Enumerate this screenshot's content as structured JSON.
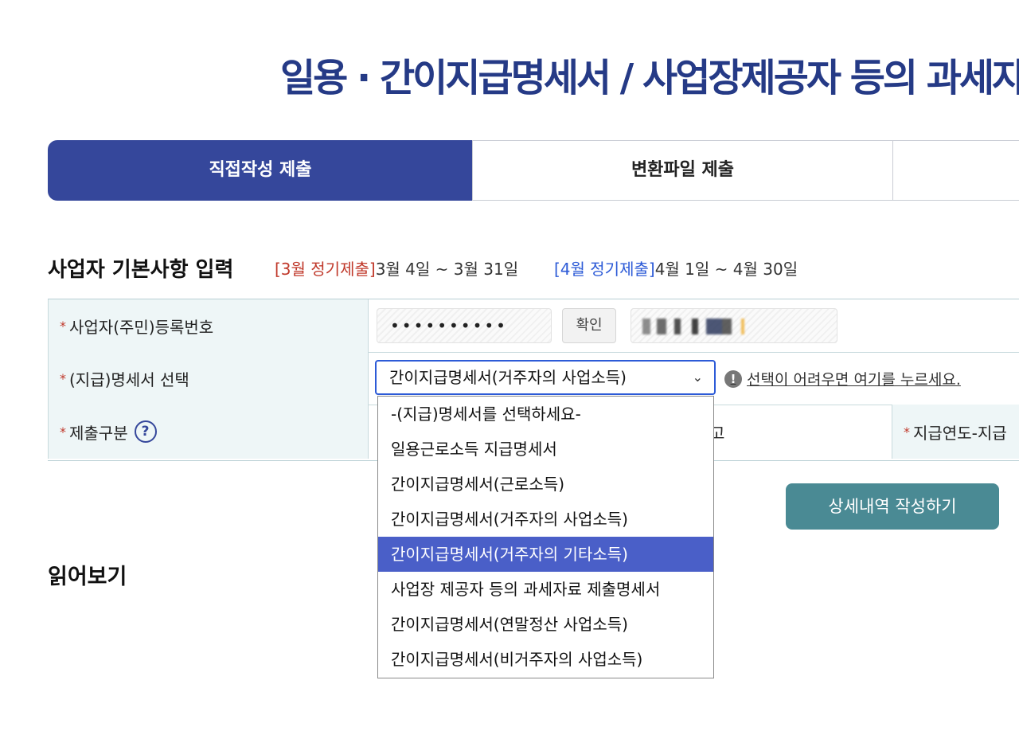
{
  "page": {
    "title": "일용 · 간이지급명세서 / 사업장제공자 등의 과세자"
  },
  "tabs": [
    {
      "label": "직접작성 제출",
      "active": true
    },
    {
      "label": "변환파일 제출",
      "active": false
    },
    {
      "label": "",
      "active": false
    }
  ],
  "section": {
    "title": "사업자 기본사항 입력",
    "march_tag": "[3월 정기제출]",
    "march_range": "3월 4일 ~ 3월 31일",
    "april_tag": "[4월 정기제출]",
    "april_range": "4월 1일 ~ 4월 30일"
  },
  "form": {
    "required_mark": "*",
    "reg_no_label": "사업자(주민)등록번호",
    "reg_no_value": "••••••••••",
    "confirm_label": "확인",
    "statement_label": "(지급)명세서 선택",
    "statement_selected": "간이지급명세서(거주자의 사업소득)",
    "help_link": "선택이 어려우면 여기를 누르세요.",
    "submit_type_label": "제출구분",
    "submit_type_fragment": "고",
    "year_label": "지급연도-지급"
  },
  "dropdown": {
    "options": [
      "-(지급)명세서를 선택하세요-",
      "일용근로소득 지급명세서",
      "간이지급명세서(근로소득)",
      "간이지급명세서(거주자의 사업소득)",
      "간이지급명세서(거주자의 기타소득)",
      "사업장 제공자 등의 과세자료 제출명세서",
      "간이지급명세서(연말정산 사업소득)",
      "간이지급명세서(비거주자의 사업소득)"
    ],
    "highlighted_index": 4
  },
  "buttons": {
    "detail": "상세내역 작성하기"
  },
  "read_more": {
    "title": "읽어보기"
  },
  "icons": {
    "help": "?",
    "info": "!",
    "chevron": "⌄"
  },
  "colors": {
    "primary": "#35479b",
    "teal": "#4a8a94",
    "highlight": "#4a5fc8",
    "red": "#c0392b",
    "blue": "#2d5bd7"
  }
}
